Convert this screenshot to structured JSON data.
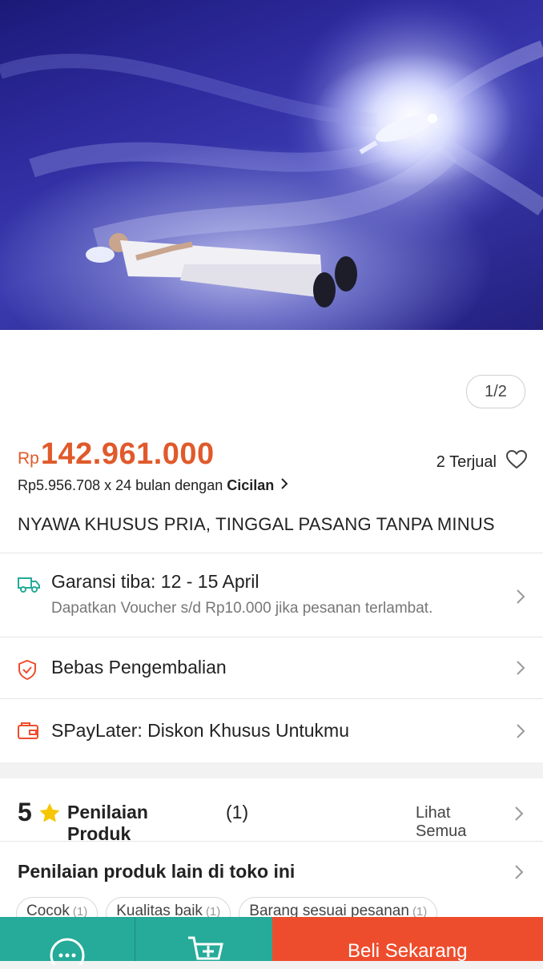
{
  "product": {
    "image_counter": "1/2",
    "price_currency": "Rp",
    "price_amount": "142.961.000",
    "sold": "2 Terjual",
    "installment_text": "Rp5.956.708 x 24 bulan dengan",
    "installment_link": "Cicilan",
    "title": "NYAWA KHUSUS PRIA, TINGGAL PASANG TANPA MINUS"
  },
  "shipping": {
    "label": "Garansi tiba: 12 - 15 April",
    "sub": "Dapatkan Voucher s/d Rp10.000 jika pesanan terlambat.",
    "icon": "truck-icon"
  },
  "returns": {
    "label": "Bebas Pengembalian",
    "icon": "shield-check-icon"
  },
  "paylater": {
    "label": "SPayLater: Diskon Khusus Untukmu",
    "icon": "wallet-card-icon"
  },
  "rating": {
    "score": "5",
    "label": "Penilaian Produk",
    "count": "(1)",
    "see_all": "Lihat Semua"
  },
  "shop_reviews": {
    "label": "Penilaian produk lain di toko ini",
    "chips": [
      {
        "label": "Cocok",
        "count": "(1)"
      },
      {
        "label": "Kualitas baik",
        "count": "(1)"
      },
      {
        "label": "Barang sesuai pesanan",
        "count": "(1)"
      }
    ]
  },
  "bottom_bar": {
    "buy_label": "Beli Sekarang",
    "chat_icon": "chat-icon",
    "cart_icon": "add-to-cart-icon"
  },
  "colors": {
    "price": "#e05a2b",
    "accent_teal": "#26aa99",
    "buy_orange": "#ee4d2d",
    "icon_teal": "#26aa99",
    "icon_orange": "#ee4d2d"
  }
}
